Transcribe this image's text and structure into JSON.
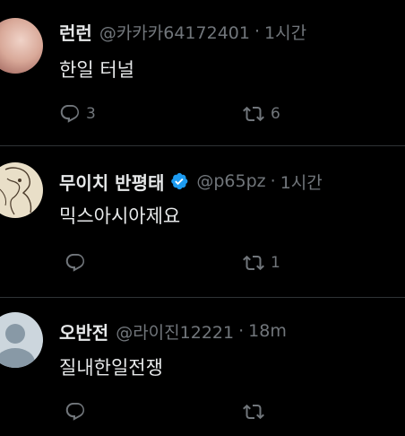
{
  "tweets": [
    {
      "name": "런런",
      "handle": "@카카카64172401",
      "dot": "·",
      "time": "1시간",
      "text": "한일 터널",
      "reply_count": "3",
      "retweet_count": "6",
      "verified": false
    },
    {
      "name": "무이치 반평태",
      "handle": "@p65pz",
      "dot": "·",
      "time": "1시간",
      "text": "믹스아시아제요",
      "reply_count": "",
      "retweet_count": "1",
      "verified": true
    },
    {
      "name": "오반전",
      "handle": "@라이진12221",
      "dot": "·",
      "time": "18m",
      "text": "질내한일전쟁",
      "reply_count": "",
      "retweet_count": "",
      "verified": false
    }
  ],
  "colors": {
    "background": "#000000",
    "text": "#e7e9ea",
    "secondary": "#71767b",
    "divider": "#2f3336",
    "verified": "#1d9bf0"
  },
  "icons": [
    "reply-icon",
    "retweet-icon",
    "verified-badge-icon",
    "default-avatar-icon"
  ]
}
